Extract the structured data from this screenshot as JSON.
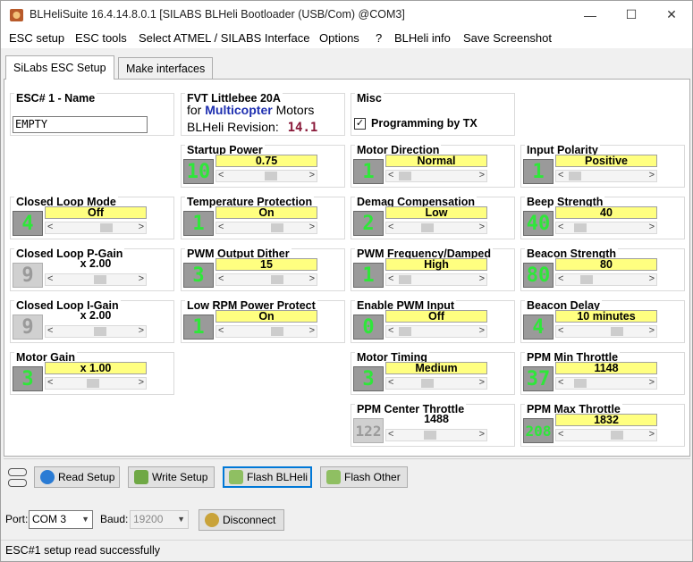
{
  "window": {
    "title": "BLHeliSuite 16.4.14.8.0.1  [SILABS BLHeli Bootloader (USB/Com) @COM3]",
    "min": "—",
    "max": "☐",
    "close": "✕"
  },
  "menu": [
    "ESC setup",
    "ESC tools",
    "Select ATMEL / SILABS Interface",
    "Options",
    "?",
    "BLHeli info",
    "Save Screenshot"
  ],
  "tabs": [
    "SiLabs ESC Setup",
    "Make interfaces"
  ],
  "esc_name": {
    "title": "ESC# 1 - Name",
    "value": "EMPTY"
  },
  "firmware": {
    "title": "FVT Littlebee 20A",
    "for": "for",
    "type": "Multicopter",
    "motors": "Motors",
    "rev_label": "BLHeli Revision:",
    "rev": "14.1"
  },
  "misc": {
    "title": "Misc",
    "checkbox_label": "Programming by TX",
    "checked": true
  },
  "params": [
    {
      "id": "startup-power",
      "title": "Startup Power",
      "box": "10",
      "label": "0.75",
      "pos": 0.55,
      "boxed": true
    },
    {
      "id": "motor-direction",
      "title": "Motor Direction",
      "box": "1",
      "label": "Normal",
      "pos": 0.02,
      "boxed": true
    },
    {
      "id": "input-polarity",
      "title": "Input Polarity",
      "box": "1",
      "label": "Positive",
      "pos": 0.02,
      "boxed": true
    },
    {
      "id": "closed-loop-mode",
      "title": "Closed Loop Mode",
      "box": "4",
      "label": "Off",
      "pos": 0.65,
      "boxed": true
    },
    {
      "id": "temperature-protection",
      "title": "Temperature Protection",
      "box": "1",
      "label": "On",
      "pos": 0.65,
      "boxed": true
    },
    {
      "id": "demag-compensation",
      "title": "Demag Compensation",
      "box": "2",
      "label": "Low",
      "pos": 0.35,
      "boxed": true
    },
    {
      "id": "beep-strength",
      "title": "Beep Strength",
      "box": "40",
      "label": "40",
      "pos": 0.1,
      "boxed": true
    },
    {
      "id": "closed-loop-p-gain",
      "title": "Closed Loop P-Gain",
      "box": "9",
      "label": "x 2.00",
      "pos": 0.55,
      "boxed": false,
      "dim": true
    },
    {
      "id": "pwm-output-dither",
      "title": "PWM Output Dither",
      "box": "3",
      "label": "15",
      "pos": 0.65,
      "boxed": true
    },
    {
      "id": "pwm-frequency-damped",
      "title": "PWM Frequency/Damped",
      "box": "1",
      "label": "High",
      "pos": 0.02,
      "boxed": true
    },
    {
      "id": "beacon-strength",
      "title": "Beacon Strength",
      "box": "80",
      "label": "80",
      "pos": 0.2,
      "boxed": true
    },
    {
      "id": "closed-loop-i-gain",
      "title": "Closed Loop I-Gain",
      "box": "9",
      "label": "x 2.00",
      "pos": 0.55,
      "boxed": false,
      "dim": true
    },
    {
      "id": "low-rpm-power-protect",
      "title": "Low RPM Power Protect",
      "box": "1",
      "label": "On",
      "pos": 0.65,
      "boxed": true
    },
    {
      "id": "enable-pwm-input",
      "title": "Enable PWM Input",
      "box": "0",
      "label": "Off",
      "pos": 0.02,
      "boxed": true
    },
    {
      "id": "beacon-delay",
      "title": "Beacon Delay",
      "box": "4",
      "label": "10 minutes",
      "pos": 0.65,
      "boxed": true
    },
    {
      "id": "motor-gain",
      "title": "Motor Gain",
      "box": "3",
      "label": "x 1.00",
      "pos": 0.45,
      "boxed": true
    },
    {
      "id": "motor-timing",
      "title": "Motor Timing",
      "box": "3",
      "label": "Medium",
      "pos": 0.35,
      "boxed": true
    },
    {
      "id": "ppm-min-throttle",
      "title": "PPM Min Throttle",
      "box": "37",
      "label": "1148",
      "pos": 0.1,
      "boxed": true
    },
    {
      "id": "ppm-center-throttle",
      "title": "PPM Center Throttle",
      "box": "122",
      "label": "1488",
      "pos": 0.4,
      "boxed": false,
      "dim": true
    },
    {
      "id": "ppm-max-throttle",
      "title": "PPM Max Throttle",
      "box": "208",
      "label": "1832",
      "pos": 0.65,
      "boxed": true
    }
  ],
  "arrows": {
    "left": "<",
    "right": ">"
  },
  "buttons": {
    "read": "Read Setup",
    "write": "Write Setup",
    "flash": "Flash BLHeli",
    "flash_other": "Flash Other",
    "disconnect": "Disconnect"
  },
  "port": {
    "label": "Port:",
    "value": "COM 3",
    "baud_label": "Baud:",
    "baud": "19200"
  },
  "status": "ESC#1 setup read successfully"
}
